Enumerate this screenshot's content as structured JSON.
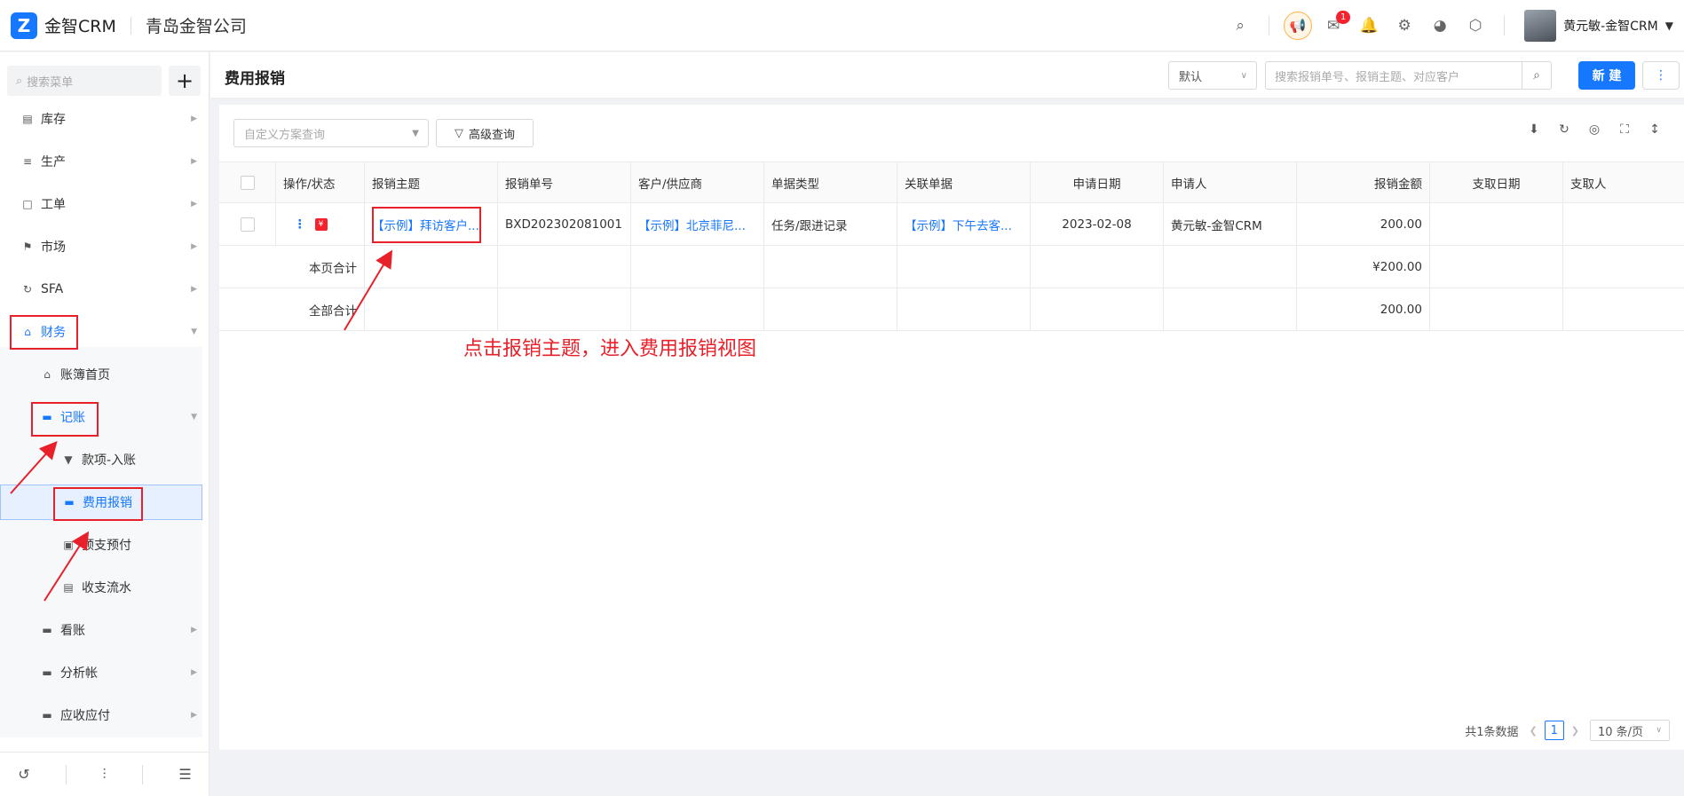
{
  "app": {
    "logo_text": "金智CRM",
    "logo_glyph": "Z",
    "company": "青岛金智公司"
  },
  "topbar": {
    "icons": [
      "search-icon",
      "speaker-icon",
      "mail-icon",
      "bell-icon",
      "gear-icon",
      "pie-chart-icon",
      "cube-icon"
    ],
    "mail_badge": "1",
    "user_name": "黄元敏-金智CRM"
  },
  "sidebar": {
    "search_placeholder": "搜索菜单",
    "items": [
      {
        "label": "库存",
        "icon": "building-icon"
      },
      {
        "label": "生产",
        "icon": "sliders-icon"
      },
      {
        "label": "工单",
        "icon": "document-icon"
      },
      {
        "label": "市场",
        "icon": "flag-icon"
      },
      {
        "label": "SFA",
        "icon": "cycle-icon"
      },
      {
        "label": "财务",
        "icon": "home-icon"
      },
      {
        "label": "账簿首页",
        "icon": "home-icon"
      },
      {
        "label": "记账",
        "icon": "folder-icon"
      },
      {
        "label": "款项-入账",
        "icon": "pin-icon"
      },
      {
        "label": "费用报销",
        "icon": "card-icon"
      },
      {
        "label": "预支预付",
        "icon": "wallet-icon"
      },
      {
        "label": "收支流水",
        "icon": "ledger-icon"
      },
      {
        "label": "看账",
        "icon": "folder-icon"
      },
      {
        "label": "分析帐",
        "icon": "folder-icon"
      },
      {
        "label": "应收应付",
        "icon": "folder-icon"
      }
    ]
  },
  "page": {
    "title": "费用报销",
    "view_select": "默认",
    "search_placeholder": "搜索报销单号、报销主题、对应客户",
    "new_button": "新 建"
  },
  "filter": {
    "scheme_placeholder": "自定义方案查询",
    "advanced_label": "高级查询"
  },
  "table": {
    "columns": [
      "操作/状态",
      "报销主题",
      "报销单号",
      "客户/供应商",
      "单据类型",
      "关联单据",
      "申请日期",
      "申请人",
      "报销金额",
      "支取日期",
      "支取人"
    ],
    "rows": [
      {
        "subject": "【示例】拜访客户...",
        "number": "BXD202302081001",
        "customer": "【示例】北京菲尼...",
        "doc_type": "任务/跟进记录",
        "related": "【示例】下午去客...",
        "date": "2023-02-08",
        "applicant": "黄元敏-金智CRM",
        "amount": "200.00"
      }
    ],
    "page_total_label": "本页合计",
    "page_total_amount": "¥200.00",
    "all_total_label": "全部合计",
    "all_total_amount": "200.00"
  },
  "pager": {
    "total_text": "共1条数据",
    "current_page": "1",
    "page_size": "10 条/页"
  },
  "annotation": {
    "text": "点击报销主题，进入费用报销视图",
    "color": "#e8202a"
  },
  "colors": {
    "accent": "#1677ff",
    "annotation": "#e8202a",
    "active_bg": "#e6f0ff"
  }
}
